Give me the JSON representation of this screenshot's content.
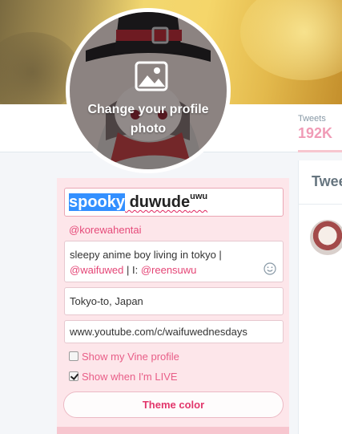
{
  "avatar": {
    "change_photo_label": "Change your profile photo"
  },
  "stats": {
    "tweets_label": "Tweets",
    "tweets_value": "192K"
  },
  "timeline": {
    "title": "Twee"
  },
  "profile_form": {
    "name_selected": "spooky",
    "name_rest": " duwude",
    "name_superscript": "uwu",
    "handle": "@korewahentai",
    "bio_text": "sleepy anime boy living in tokyo | ",
    "bio_mention_1": "@waifuwed",
    "bio_separator": " | I: ",
    "bio_mention_2": "@reensuwu",
    "location": "Tokyo-to, Japan",
    "website": "www.youtube.com/c/waifuwednesdays",
    "vine_label": "Show my Vine profile",
    "vine_checked": false,
    "live_label": "Show when I'm LIVE",
    "live_checked": true,
    "theme_button": "Theme color"
  },
  "icons": {
    "photo": "image-icon",
    "emoji": "smiley-icon"
  },
  "colors": {
    "accent": "#e0245e",
    "panel": "#fde6ea",
    "selection": "#3390ff"
  }
}
